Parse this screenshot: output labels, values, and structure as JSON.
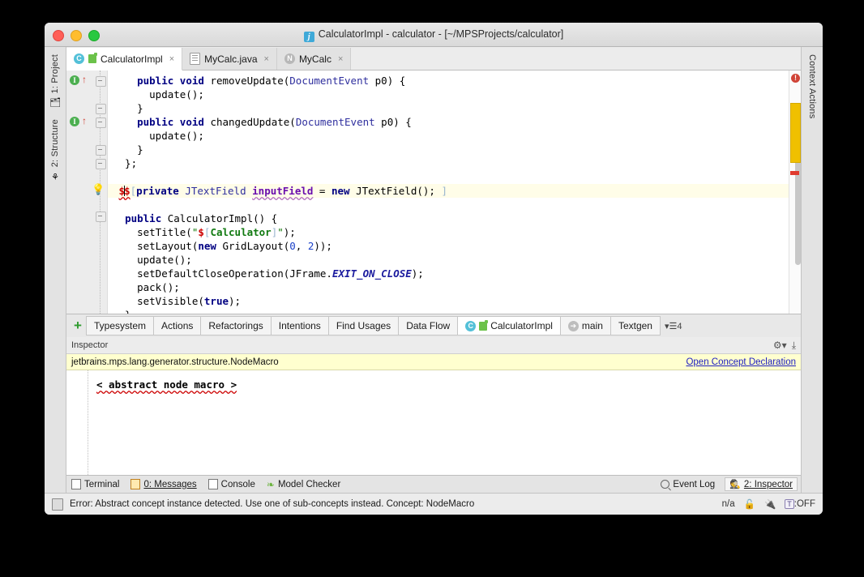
{
  "window": {
    "title": "CalculatorImpl - calculator - [~/MPSProjects/calculator]",
    "title_icon": "mps-project-icon",
    "traffic": {
      "close": "close-button",
      "minimize": "minimize-button",
      "zoom": "zoom-button"
    }
  },
  "left_sidebar": {
    "items": [
      {
        "label": "1: Project",
        "icon": "project-icon"
      },
      {
        "label": "2: Structure",
        "icon": "structure-icon"
      }
    ]
  },
  "right_sidebar": {
    "items": [
      {
        "label": "Context Actions",
        "icon": "context-actions-icon"
      }
    ]
  },
  "editor_tabs": [
    {
      "label": "CalculatorImpl",
      "icon": "concept-c-icon",
      "badge": "generator-badge",
      "active": true,
      "close": "×"
    },
    {
      "label": "MyCalc.java",
      "icon": "java-file-icon",
      "active": false,
      "close": "×"
    },
    {
      "label": "MyCalc",
      "icon": "node-n-icon",
      "active": false,
      "close": "×"
    }
  ],
  "editor": {
    "lines": [
      "public void removeUpdate(DocumentEvent p0) {",
      "update();",
      "}",
      "public void changedUpdate(DocumentEvent p0) {",
      "update();",
      "}",
      "};",
      "",
      "$$[private JTextField inputField = new JTextField(); ]",
      "",
      "public CalculatorImpl() {",
      "setTitle(\"$[Calculator]\");",
      "setLayout(new GridLayout(0, 2));",
      "update();",
      "setDefaultCloseOperation(JFrame.EXIT_ON_CLOSE);",
      "pack();",
      "setVisible(true);",
      "}"
    ],
    "tokens": {
      "kw_public": "public",
      "kw_void": "void",
      "kw_new": "new",
      "kw_private": "private",
      "kw_true": "true",
      "m_removeUpdate": "removeUpdate",
      "m_changedUpdate": "changedUpdate",
      "t_DocumentEvent": "DocumentEvent",
      "p_p0": "p0",
      "m_update": "update",
      "t_JTextField": "JTextField",
      "f_inputField": "inputField",
      "c_CalculatorImpl": "CalculatorImpl",
      "m_setTitle": "setTitle",
      "s_Calculator": "Calculator",
      "m_setLayout": "setLayout",
      "t_GridLayout": "GridLayout",
      "n_0": "0",
      "n_2": "2",
      "m_setDefaultCloseOperation": "setDefaultCloseOperation",
      "t_JFrame": "JFrame",
      "const_EXIT_ON_CLOSE": "EXIT_ON_CLOSE",
      "m_pack": "pack",
      "m_setVisible": "setVisible",
      "macro_dollar": "$",
      "bracket_open": "[",
      "bracket_close": "]"
    },
    "gutter": {
      "implements_marker": "I",
      "override_arrow": "↑",
      "intention_bulb": "💡"
    },
    "stripe": {
      "error_icon": "!",
      "thumb_color": "#f0c000",
      "error_mark_color": "#e03b2f"
    }
  },
  "tool_tabs": {
    "add_label": "+",
    "tabs": [
      {
        "label": "Typesystem",
        "selected": false
      },
      {
        "label": "Actions",
        "selected": false
      },
      {
        "label": "Refactorings",
        "selected": false
      },
      {
        "label": "Intentions",
        "selected": false
      },
      {
        "label": "Find Usages",
        "selected": false
      },
      {
        "label": "Data Flow",
        "selected": false
      },
      {
        "label": "CalculatorImpl",
        "selected": true,
        "icon": "concept-c-icon",
        "badge": "generator-badge"
      },
      {
        "label": "main",
        "selected": false,
        "icon": "arrow-right-icon"
      },
      {
        "label": "Textgen",
        "selected": false
      }
    ],
    "overflow_count": "4"
  },
  "inspector": {
    "header_label": "Inspector",
    "gear_icon": "gear-icon",
    "hide_icon": "hide-panel-icon",
    "concept_fqn": "jetbrains.mps.lang.generator.structure.NodeMacro",
    "open_declaration_link": "Open Concept Declaration",
    "content_text": "< abstract node macro >"
  },
  "status_tabs": {
    "left": [
      {
        "label": "Terminal",
        "icon": "terminal-icon"
      },
      {
        "label": "0: Messages",
        "icon": "messages-icon",
        "mnemonic": "0"
      },
      {
        "label": "Console",
        "icon": "console-icon"
      },
      {
        "label": "Model Checker",
        "icon": "model-checker-icon"
      }
    ],
    "right": [
      {
        "label": "Event Log",
        "icon": "search-icon",
        "active": false
      },
      {
        "label": "2: Inspector",
        "icon": "inspector-detective-icon",
        "active": true,
        "mnemonic": "2"
      }
    ]
  },
  "status_bar": {
    "icon": "status-window-icon",
    "message": "Error: Abstract concept instance detected. Use one of sub-concepts instead. Concept: NodeMacro",
    "position": "n/a",
    "lock_icon": "lock-open-icon",
    "plug_icon": "power-plug-icon",
    "typing_badge": "T",
    "typing_state": ":OFF"
  },
  "colors": {
    "accent_yellow": "#ffffcf",
    "error_red": "#cc0000",
    "link_blue": "#2020c0",
    "keyword_blue": "#000082",
    "string_green": "#0b7500"
  }
}
